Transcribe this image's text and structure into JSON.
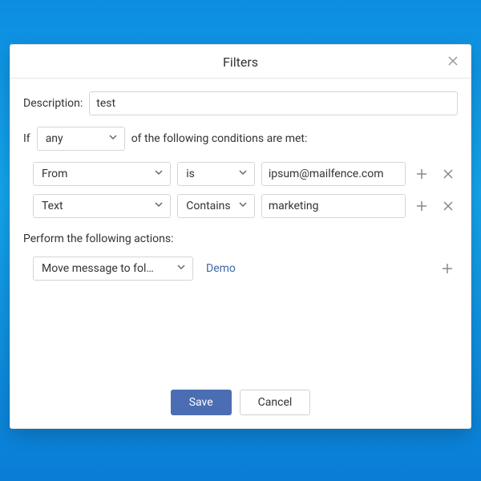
{
  "dialog": {
    "title": "Filters",
    "description_label": "Description:",
    "description_value": "test",
    "if_label": "If",
    "match_mode": "any",
    "if_tail": "of the following conditions are met:",
    "actions_label": "Perform the following actions:",
    "save_label": "Save",
    "cancel_label": "Cancel"
  },
  "conditions": [
    {
      "field": "From",
      "op": "is",
      "value": "ipsum@mailfence.com"
    },
    {
      "field": "Text",
      "op": "Contains",
      "value": "marketing"
    }
  ],
  "actions": [
    {
      "type": "Move message to fol…",
      "target": "Demo"
    }
  ]
}
